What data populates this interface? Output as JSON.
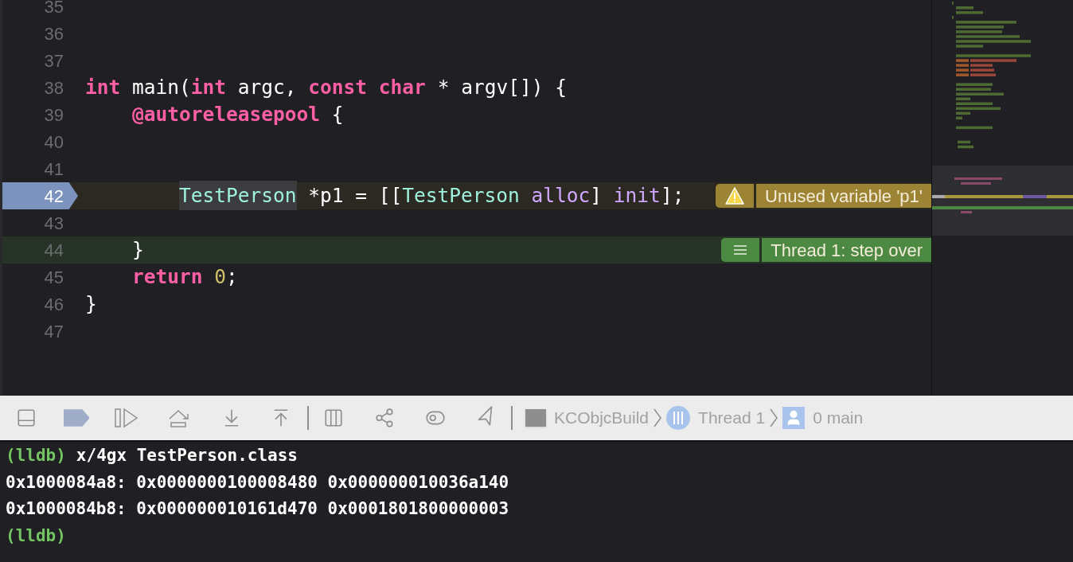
{
  "editor": {
    "lines": [
      {
        "number": "35",
        "kind": "normal"
      },
      {
        "number": "36",
        "kind": "normal"
      },
      {
        "number": "37",
        "kind": "normal"
      },
      {
        "number": "38",
        "kind": "normal",
        "tokens": [
          {
            "text": "int",
            "kind": "keyword"
          },
          {
            "text": " main(",
            "kind": "plain"
          },
          {
            "text": "int",
            "kind": "keyword"
          },
          {
            "text": " argc, ",
            "kind": "plain"
          },
          {
            "text": "const char",
            "kind": "keyword"
          },
          {
            "text": " * argv[]) {",
            "kind": "plain"
          }
        ]
      },
      {
        "number": "39",
        "kind": "normal",
        "tokens": [
          {
            "text": "    @autoreleasepool",
            "kind": "keyword"
          },
          {
            "text": " {",
            "kind": "plain"
          }
        ]
      },
      {
        "number": "40",
        "kind": "normal"
      },
      {
        "number": "41",
        "kind": "normal"
      },
      {
        "number": "42",
        "kind": "pc",
        "tokens": [
          {
            "text": "        TestPerson",
            "kind": "type",
            "highlighted": true
          },
          {
            "text": " *p1 = [[",
            "kind": "plain"
          },
          {
            "text": "TestPerson ",
            "kind": "type"
          },
          {
            "text": "alloc",
            "kind": "method"
          },
          {
            "text": "] ",
            "kind": "plain"
          },
          {
            "text": "init",
            "kind": "method"
          },
          {
            "text": "];",
            "kind": "plain"
          }
        ],
        "annotation": {
          "kind": "warning",
          "text": "Unused variable 'p1'"
        }
      },
      {
        "number": "43",
        "kind": "normal"
      },
      {
        "number": "44",
        "kind": "thread",
        "tokens": [
          {
            "text": "    }",
            "kind": "plain"
          }
        ],
        "annotation": {
          "kind": "thread",
          "text": "Thread 1: step over"
        }
      },
      {
        "number": "45",
        "kind": "normal",
        "tokens": [
          {
            "text": "    return ",
            "kind": "keyword"
          },
          {
            "text": "0",
            "kind": "number"
          },
          {
            "text": ";",
            "kind": "plain"
          }
        ]
      },
      {
        "number": "46",
        "kind": "normal",
        "tokens": [
          {
            "text": "}",
            "kind": "plain"
          }
        ]
      },
      {
        "number": "47",
        "kind": "normal"
      }
    ]
  },
  "debug_bar": {
    "breakpoints_active": true,
    "breadcrumb": [
      {
        "kind": "target",
        "label": "KCObjcBuild"
      },
      {
        "kind": "thread",
        "label": "Thread 1"
      },
      {
        "kind": "frame",
        "label": "0 main"
      }
    ]
  },
  "console": {
    "lines": [
      {
        "kind": "input",
        "prompt": "(lldb)",
        "command": "x/4gx TestPerson.class"
      },
      {
        "kind": "output",
        "text": "0x1000084a8: 0x0000000100008480 0x000000010036a140"
      },
      {
        "kind": "output",
        "text": "0x1000084b8: 0x000000010161d470 0x0001801800000003"
      },
      {
        "kind": "input",
        "prompt": "(lldb)"
      }
    ]
  }
}
